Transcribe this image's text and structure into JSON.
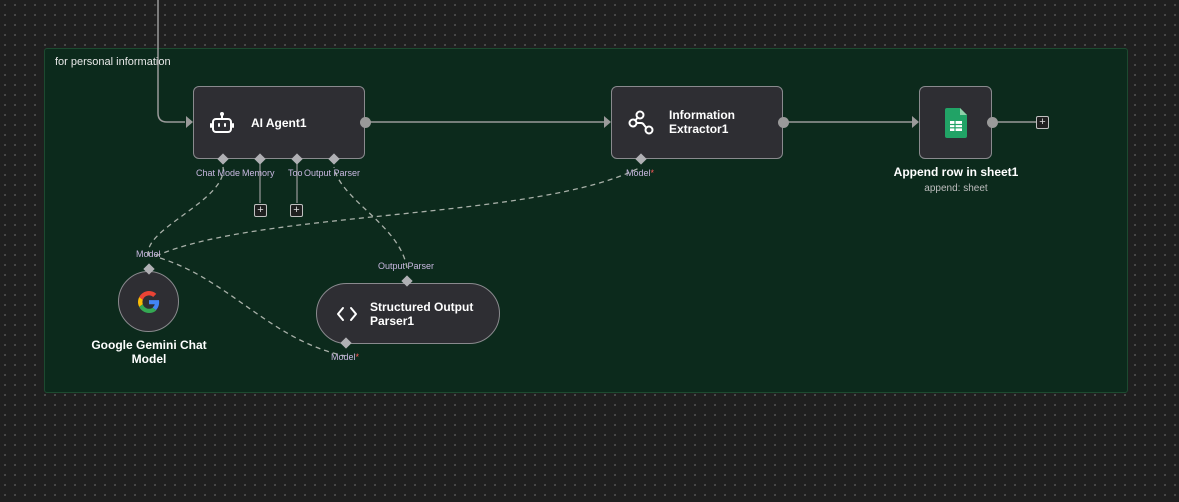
{
  "sticky_note": {
    "text": "for personal information"
  },
  "nodes": {
    "ai_agent": {
      "title": "AI Agent1",
      "ports": {
        "chat_model": "Chat Mode",
        "memory": "Memory",
        "tool": "Too",
        "output_parser": "Output Parser"
      }
    },
    "info_extractor": {
      "title_line1": "Information",
      "title_line2": "Extractor1",
      "ports": {
        "model": "Model",
        "required_mark": "*"
      }
    },
    "sheets": {
      "title": "Append row in sheet1",
      "subtitle": "append: sheet"
    },
    "gemini": {
      "title_line1": "Google Gemini Chat",
      "title_line2": "Model",
      "ports": {
        "model": "Model"
      }
    },
    "parser": {
      "title_line1": "Structured Output",
      "title_line2": "Parser1",
      "ports": {
        "output_parser": "Output Parser",
        "model": "Model",
        "required_mark": "*"
      }
    }
  },
  "add_button_symbol": "+",
  "icons": {
    "ai_agent": "robot-icon",
    "info_extractor": "share-nodes-icon",
    "sheets": "google-sheets-icon",
    "gemini": "google-g-icon",
    "parser": "code-brackets-icon",
    "add": "plus-icon"
  },
  "colors": {
    "canvas": "#1f1f1f",
    "sticky_bg": "#0c2a1c",
    "node_bg": "#2e2e33",
    "connection": "#9a9a9a",
    "sub_connection": "#a8b0a8",
    "port_label": "#c8b8e0",
    "sheets_green": "#21a366"
  }
}
